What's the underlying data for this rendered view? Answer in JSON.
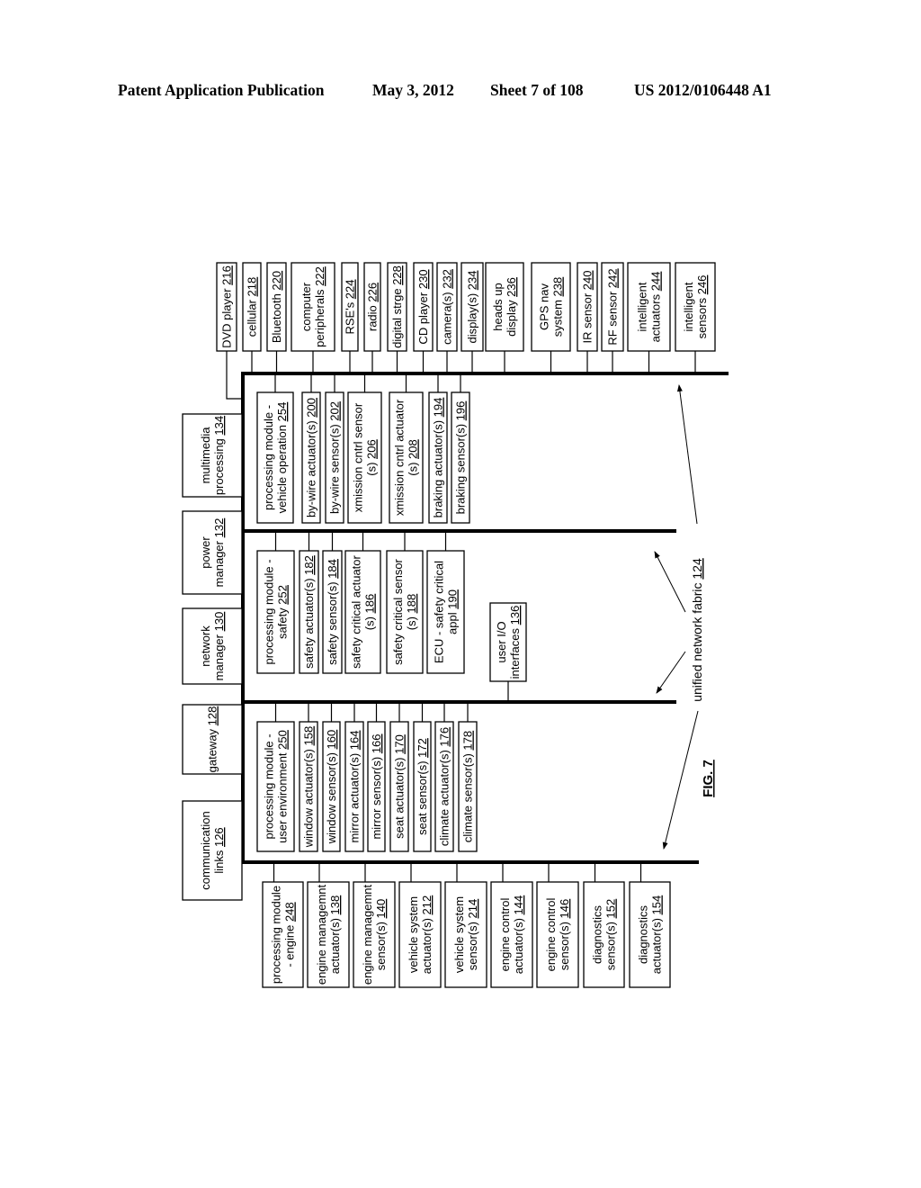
{
  "header": {
    "publication": "Patent Application Publication",
    "date": "May 3, 2012",
    "sheet": "Sheet 7 of 108",
    "number": "US 2012/0106448 A1"
  },
  "figure": {
    "label": "FIG. 7",
    "fabric_label": "unified network fabric",
    "fabric_ref": "124"
  },
  "left_column": [
    {
      "lines": [
        "communication",
        "links"
      ],
      "ref": "126"
    },
    {
      "lines": [
        "gateway"
      ],
      "ref": "128"
    },
    {
      "lines": [
        "network",
        "manager"
      ],
      "ref": "130"
    },
    {
      "lines": [
        "power",
        "manager"
      ],
      "ref": "132"
    },
    {
      "lines": [
        "multimedia",
        "processing"
      ],
      "ref": "134"
    }
  ],
  "top_row": [
    {
      "lines": [
        "DVD player"
      ],
      "ref": "216"
    },
    {
      "lines": [
        "cellular"
      ],
      "ref": "218"
    },
    {
      "lines": [
        "Bluetooth"
      ],
      "ref": "220"
    },
    {
      "lines": [
        "computer",
        "peripherals"
      ],
      "ref": "222"
    },
    {
      "lines": [
        "RSE's"
      ],
      "ref": "224"
    },
    {
      "lines": [
        "radio"
      ],
      "ref": "226"
    },
    {
      "lines": [
        "digital strge"
      ],
      "ref": "228"
    },
    {
      "lines": [
        "CD player"
      ],
      "ref": "230"
    },
    {
      "lines": [
        "camera(s)"
      ],
      "ref": "232"
    },
    {
      "lines": [
        "display(s)"
      ],
      "ref": "234"
    },
    {
      "lines": [
        "heads up",
        "display"
      ],
      "ref": "236"
    },
    {
      "lines": [
        "GPS nav",
        "system"
      ],
      "ref": "238"
    },
    {
      "lines": [
        "IR sensor"
      ],
      "ref": "240"
    },
    {
      "lines": [
        "RF sensor"
      ],
      "ref": "242"
    },
    {
      "lines": [
        "intelligent",
        "actuators"
      ],
      "ref": "244"
    },
    {
      "lines": [
        "intelligent",
        "sensors"
      ],
      "ref": "246"
    }
  ],
  "bottom_row": [
    {
      "lines": [
        "processing module",
        "- engine"
      ],
      "ref": "248"
    },
    {
      "lines": [
        "engine managemnt",
        "actuator(s)"
      ],
      "ref": "138"
    },
    {
      "lines": [
        "engine managemnt",
        "sensor(s)"
      ],
      "ref": "140"
    },
    {
      "lines": [
        "vehicle system",
        "actuator(s)"
      ],
      "ref": "212"
    },
    {
      "lines": [
        "vehicle system",
        "sensor(s)"
      ],
      "ref": "214"
    },
    {
      "lines": [
        "engine control",
        "actuator(s)"
      ],
      "ref": "144"
    },
    {
      "lines": [
        "engine control",
        "sensor(s)"
      ],
      "ref": "146"
    },
    {
      "lines": [
        "diagnostics",
        "sensor(s)"
      ],
      "ref": "152"
    },
    {
      "lines": [
        "diagnostics",
        "actuator(s)"
      ],
      "ref": "154"
    }
  ],
  "groups": {
    "vehicle_operation": [
      {
        "lines": [
          "processing module -",
          "vehicle operation"
        ],
        "ref": "254"
      },
      {
        "lines": [
          "by-wire actuator(s)"
        ],
        "ref": "200"
      },
      {
        "lines": [
          "by-wire sensor(s)"
        ],
        "ref": "202"
      },
      {
        "lines": [
          "xmission cntrl sensor",
          "(s)"
        ],
        "ref": "206"
      },
      {
        "lines": [
          "xmission cntrl actuator",
          "(s)"
        ],
        "ref": "208"
      },
      {
        "lines": [
          "braking actuator(s)"
        ],
        "ref": "194"
      },
      {
        "lines": [
          "braking sensor(s)"
        ],
        "ref": "196"
      }
    ],
    "safety": [
      {
        "lines": [
          "processing module -",
          "safety"
        ],
        "ref": "252"
      },
      {
        "lines": [
          "safety actuator(s)"
        ],
        "ref": "182"
      },
      {
        "lines": [
          "safety sensor(s)"
        ],
        "ref": "184"
      },
      {
        "lines": [
          "safety critical actuator",
          "(s)"
        ],
        "ref": "186"
      },
      {
        "lines": [
          "safety critical sensor",
          "(s)"
        ],
        "ref": "188"
      },
      {
        "lines": [
          "ECU - safety critical",
          "appl"
        ],
        "ref": "190"
      }
    ],
    "user_environment": [
      {
        "lines": [
          "processing module -",
          "user environment"
        ],
        "ref": "250"
      },
      {
        "lines": [
          "window actuator(s)"
        ],
        "ref": "158"
      },
      {
        "lines": [
          "window sensor(s)"
        ],
        "ref": "160"
      },
      {
        "lines": [
          "mirror actuator(s)"
        ],
        "ref": "164"
      },
      {
        "lines": [
          "mirror sensor(s)"
        ],
        "ref": "166"
      },
      {
        "lines": [
          "seat actuator(s)"
        ],
        "ref": "170"
      },
      {
        "lines": [
          "seat sensor(s)"
        ],
        "ref": "172"
      },
      {
        "lines": [
          "climate actuator(s)"
        ],
        "ref": "176"
      },
      {
        "lines": [
          "climate sensor(s)"
        ],
        "ref": "178"
      }
    ],
    "user_io": {
      "lines": [
        "user I/O",
        "interfaces"
      ],
      "ref": "136"
    }
  }
}
